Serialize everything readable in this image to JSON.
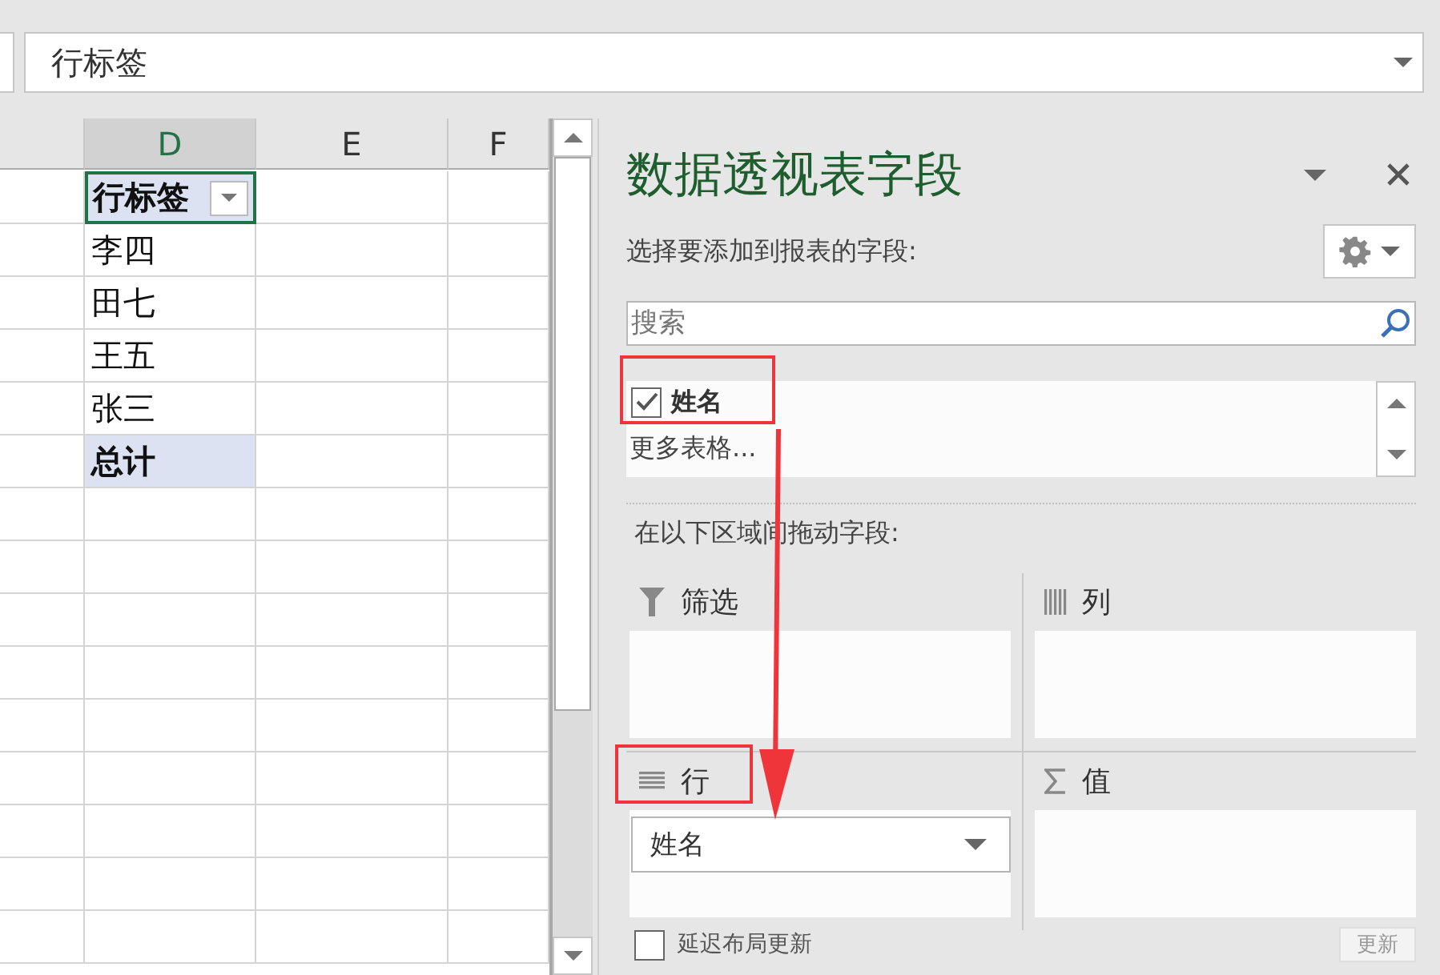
{
  "formula_bar": {
    "value": "行标签"
  },
  "sheet": {
    "columns": [
      {
        "label": "D"
      },
      {
        "label": "E"
      },
      {
        "label": "F"
      }
    ],
    "header_cell": {
      "label": "行标签",
      "selected": true
    },
    "rows": [
      "李四",
      "田七",
      "王五",
      "张三"
    ],
    "total": "总计"
  },
  "panel": {
    "title": "数据透视表字段",
    "subtitle": "选择要添加到报表的字段:",
    "search": {
      "placeholder": "搜索"
    },
    "fields": [
      {
        "label": "姓名",
        "checked": true
      }
    ],
    "more_tables": "更多表格...",
    "drag_hint": "在以下区域间拖动字段:",
    "areas": [
      {
        "kind": "filter",
        "label": "筛选"
      },
      {
        "kind": "columns",
        "label": "列"
      },
      {
        "kind": "rows",
        "label": "行",
        "items": [
          "姓名"
        ]
      },
      {
        "kind": "values",
        "label": "值"
      }
    ],
    "defer": {
      "label": "延迟布局更新",
      "checked": false
    },
    "update_button": "更新"
  }
}
